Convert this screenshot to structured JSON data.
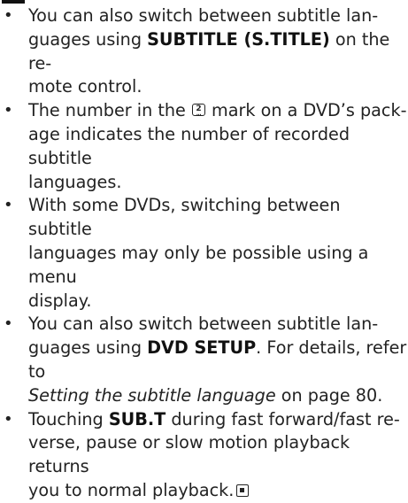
{
  "notes": [
    {
      "a": "You can also switch between subtitle lan-",
      "b": "guages using ",
      "bold": "SUBTITLE (S.TITLE)",
      "c": " on the re-",
      "d": "mote control."
    },
    {
      "a": "The number in the ",
      "icon_text": "2",
      "b": " mark on a DVD’s pack-",
      "c": "age indicates the number of recorded subtitle",
      "d": "languages."
    },
    {
      "a": "With some DVDs, switching between subtitle",
      "b": "languages may only be possible using a menu",
      "c": "display."
    },
    {
      "a": "You can also switch between subtitle lan-",
      "b": "guages using ",
      "bold": "DVD SETUP",
      "c": ". For details, refer to",
      "italic": "Setting the subtitle language",
      "d": " on page 80."
    },
    {
      "a": "Touching ",
      "bold": "SUB.T",
      "b": " during fast forward/fast re-",
      "c": "verse, pause or slow motion playback returns",
      "d": "you to normal playback."
    }
  ],
  "icons": [
    "subtitle-disc-mark-icon",
    "stop-mark-icon"
  ]
}
